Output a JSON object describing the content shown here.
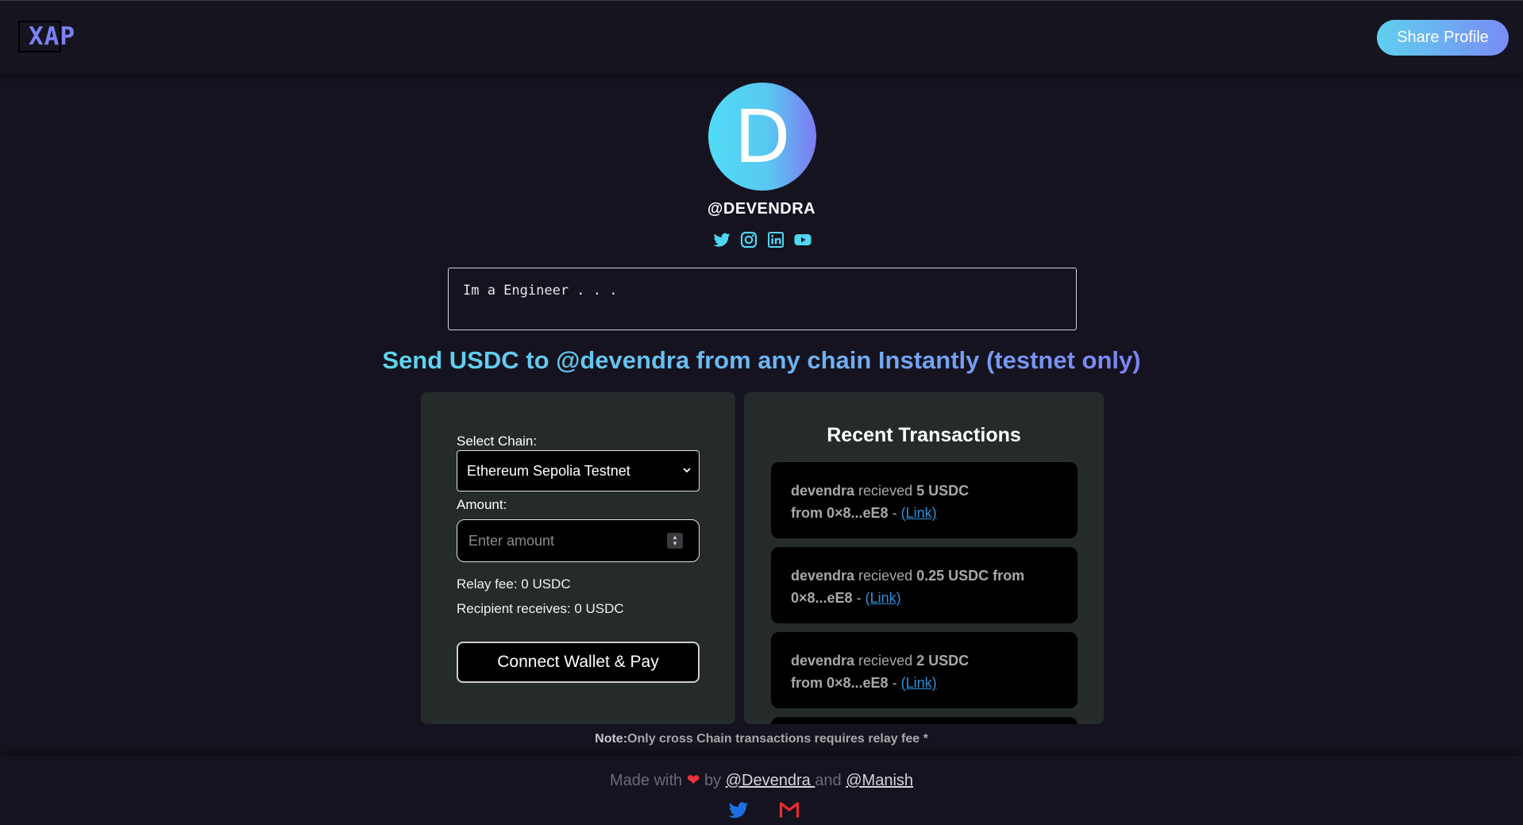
{
  "header": {
    "logo_text": "XAP",
    "share_label": "Share Profile"
  },
  "profile": {
    "avatar_letter": "D",
    "handle": "@DEVENDRA",
    "socials": [
      "twitter-icon",
      "instagram-icon",
      "linkedin-icon",
      "youtube-icon"
    ],
    "bio": "Im a Engineer . . ."
  },
  "send": {
    "title": "Send USDC to @devendra from any chain Instantly (testnet only)"
  },
  "pay": {
    "chain_label": "Select Chain:",
    "chain_value": "Ethereum Sepolia Testnet",
    "amount_label": "Amount:",
    "amount_placeholder": "Enter amount",
    "relay_fee": "Relay fee: 0 USDC",
    "recipient_receives": "Recipient receives: 0 USDC",
    "pay_button": "Connect Wallet & Pay"
  },
  "transactions": {
    "title": "Recent Transactions",
    "items": [
      {
        "user": "devendra",
        "verb": " recieved ",
        "amount": "5 USDC",
        "from": "from 0×8...eE8",
        "sep": " - ",
        "link": "(Link)"
      },
      {
        "user": "devendra",
        "verb": " recieved ",
        "amount": "0.25 USDC from 0×8...eE8",
        "from": "",
        "sep": " - ",
        "link": "(Link)"
      },
      {
        "user": "devendra",
        "verb": " recieved ",
        "amount": "2 USDC",
        "from": "from 0×8...eE8",
        "sep": " - ",
        "link": "(Link)"
      }
    ]
  },
  "note": {
    "prefix": "Note:",
    "text": "Only cross Chain transactions requires relay fee *"
  },
  "footer": {
    "made_with": "Made with",
    "by": " by ",
    "author1": "@Devendra ",
    "and": " and ",
    "author2": "@Manish"
  },
  "colors": {
    "accent_start": "#5fd0ef",
    "accent_end": "#7a8cf4",
    "background": "#15131f",
    "panel": "#252a2b",
    "link": "#2f8fd8"
  }
}
